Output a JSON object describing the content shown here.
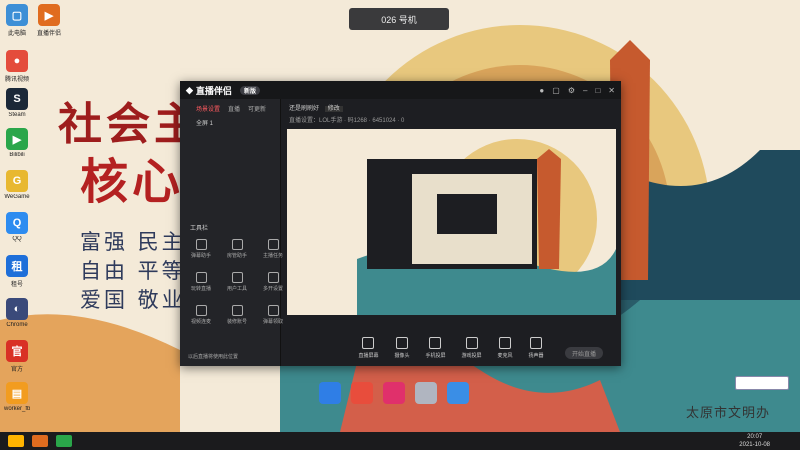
{
  "overlay": {
    "device_label": "026 号机"
  },
  "wallpaper": {
    "slogan_line1": "社会主",
    "slogan_line2": "核心",
    "values": [
      "富强 民主",
      "自由 平等",
      "爱国 敬业"
    ],
    "caption": "太原市文明办"
  },
  "desktop_icons": [
    {
      "label": "此电脑",
      "icon": "computer-icon",
      "color": "#3d8fd6"
    },
    {
      "label": "直播伴侣",
      "icon": "live-companion-icon",
      "color": "#e06c1f"
    },
    {
      "label": "腾讯视频",
      "icon": "video-icon",
      "color": "#e44c3c"
    },
    {
      "label": "Steam",
      "icon": "steam-icon",
      "color": "#1b2838"
    },
    {
      "label": "Bilibili",
      "icon": "game-icon",
      "color": "#2aa64a"
    },
    {
      "label": "WeGame",
      "icon": "wegame-icon",
      "color": "#e8b830"
    },
    {
      "label": "QQ",
      "icon": "qq-icon",
      "color": "#2d8cf0"
    },
    {
      "label": "租号",
      "icon": "rent-icon",
      "color": "#1e6fd9"
    },
    {
      "label": "Chrome",
      "icon": "browser-icon",
      "color": "#3a4a7a"
    },
    {
      "label": "官方",
      "icon": "official-icon",
      "color": "#d93025"
    },
    {
      "label": "worker_fb",
      "icon": "folder-icon",
      "color": "#f29c1f"
    }
  ],
  "app": {
    "name": "直播伴侣",
    "badge": "新版",
    "sidebar_tabs": [
      "场景设置",
      "直播",
      "可更新"
    ],
    "scene_label": "全屏 1",
    "tools_title": "工具栏",
    "tools": [
      "弹幕助手",
      "房管助手",
      "主播任务",
      "玩转直播",
      "用户工具",
      "多开设置",
      "视频连麦",
      "装修账号",
      "弹幕领取",
      "直播回放"
    ],
    "bottom_hint": "以后直播将使用此位置",
    "header_title": "还是刷刷好",
    "header_tag": "修改",
    "header_meta": "直播设置：LOL手游 · 码1268 · 6451024 · 0",
    "controls": [
      "直播屏幕",
      "摄像头",
      "手机投屏",
      "游戏投屏",
      "麦克风",
      "扬声器"
    ],
    "start_button": "开始直播"
  },
  "dock_colors": [
    "#2f7ee6",
    "#e84d3c",
    "#e0306b",
    "#b0b5c0",
    "#3a8ee6"
  ],
  "taskbar": {
    "time": "20:07",
    "date": "2021-10-08"
  }
}
